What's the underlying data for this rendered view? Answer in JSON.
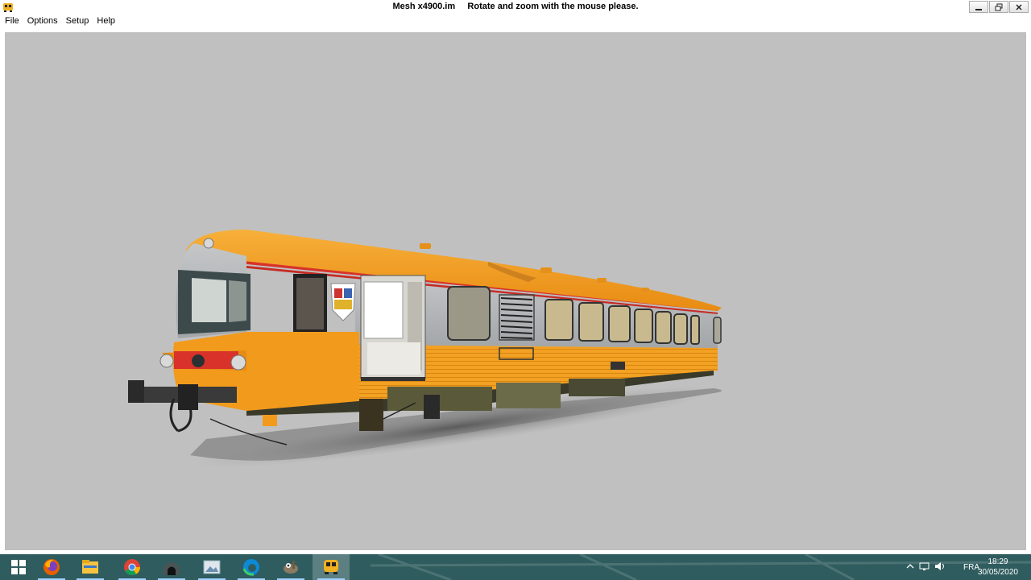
{
  "window": {
    "title": "Mesh x4900.im     Rotate and zoom with the mouse please.",
    "controls": [
      "minimize",
      "maximize",
      "close"
    ]
  },
  "menu": [
    "File",
    "Options",
    "Setup",
    "Help"
  ],
  "viewport": {
    "background": "#c0c0c0",
    "content": "3D train railcar model"
  },
  "colors": {
    "train_orange": "#f29a1c",
    "train_gray": "#a9acae",
    "stripe_red": "#d8322a",
    "taskbar": "#2f5c5f"
  },
  "taskbar": {
    "items": [
      {
        "name": "windows-start-icon"
      },
      {
        "name": "firefox-icon"
      },
      {
        "name": "file-explorer-icon"
      },
      {
        "name": "chrome-icon"
      },
      {
        "name": "tunnel-app-icon"
      },
      {
        "name": "image-viewer-icon"
      },
      {
        "name": "edge-icon"
      },
      {
        "name": "gimp-icon"
      },
      {
        "name": "train-app-icon"
      }
    ],
    "tray": {
      "language": "FRA",
      "time": "18:29",
      "date": "30/05/2020"
    }
  }
}
